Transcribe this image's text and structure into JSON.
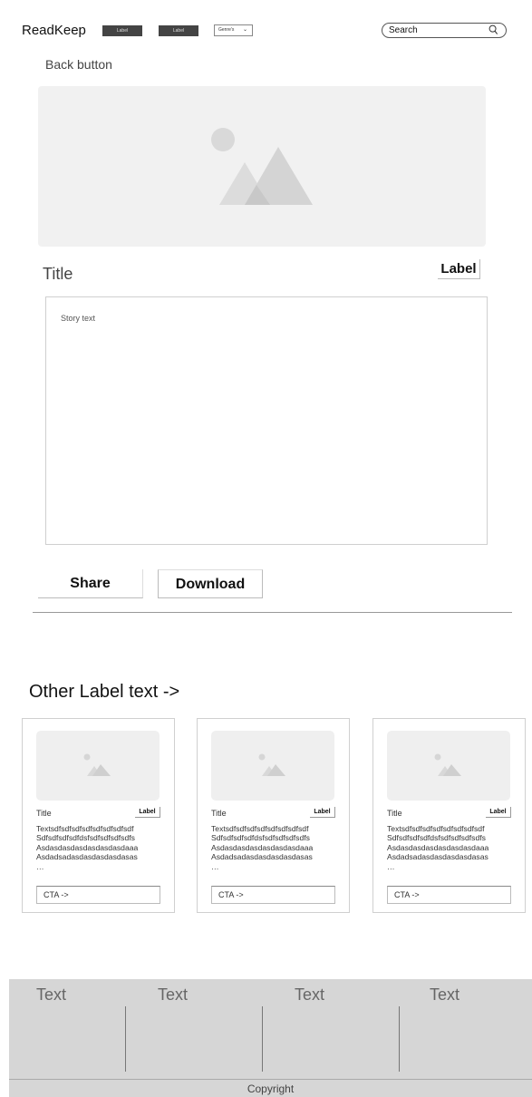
{
  "header": {
    "brand": "ReadKeep",
    "nav_labels": [
      "Label",
      "Label"
    ],
    "genre_select": {
      "value": "Genre's",
      "icon": "chevron-down-icon"
    },
    "search": {
      "placeholder": "Search",
      "icon": "search-icon"
    }
  },
  "back_label": "Back button",
  "story": {
    "title": "Title",
    "badge": "Label",
    "text": "Story text"
  },
  "actions": {
    "share": "Share",
    "download": "Download"
  },
  "related": {
    "heading": "Other Label text ->",
    "cards": [
      {
        "title": "Title",
        "badge": "Label",
        "lines": [
          "Textsdfsdfsdfsdfsdfsdfsdfsdf",
          "Sdfsdfsdfsdfdsfsdfsdfsdfsdfs",
          "Asdasdasdasdasdasdasdaaa",
          "Asdadsadasdasdasdasdasas",
          "…"
        ],
        "cta": "CTA ->"
      },
      {
        "title": "Title",
        "badge": "Label",
        "lines": [
          "Textsdfsdfsdfsdfsdfsdfsdfsdf",
          "Sdfsdfsdfsdfdsfsdfsdfsdfsdfs",
          "Asdasdasdasdasdasdasdaaa",
          "Asdadsadasdasdasdasdasas",
          "…"
        ],
        "cta": "CTA ->"
      },
      {
        "title": "Title",
        "badge": "Label",
        "lines": [
          "Textsdfsdfsdfsdfsdfsdfsdfsdf",
          "Sdfsdfsdfsdfdsfsdfsdfsdfsdfs",
          "Asdasdasdasdasdasdasdaaa",
          "Asdadsadasdasdasdasdasas",
          "…"
        ],
        "cta": "CTA ->"
      }
    ]
  },
  "footer": {
    "columns": [
      "Text",
      "Text",
      "Text",
      "Text"
    ],
    "copyright": "Copyright"
  }
}
